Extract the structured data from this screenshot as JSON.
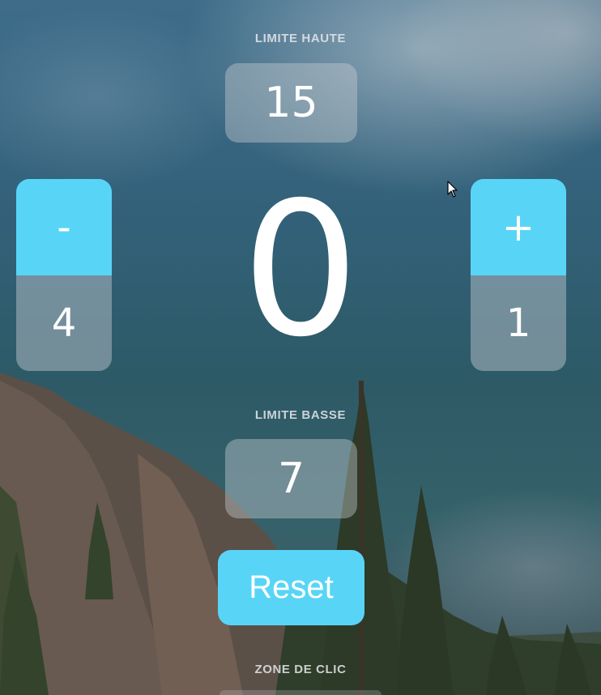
{
  "upper_limit": {
    "label": "LIMITE HAUTE",
    "value": "15"
  },
  "counter": {
    "value": "0"
  },
  "decrement": {
    "button_label": "-",
    "step": "4"
  },
  "increment": {
    "button_label": "+",
    "step": "1"
  },
  "lower_limit": {
    "label": "LIMITE BASSE",
    "value": "7"
  },
  "reset": {
    "label": "Reset"
  },
  "click_zone": {
    "label": "ZONE DE CLIC"
  },
  "colors": {
    "accent": "#58d5f6",
    "text": "#ffffff",
    "panel": "rgba(200,205,210,0.42)"
  }
}
